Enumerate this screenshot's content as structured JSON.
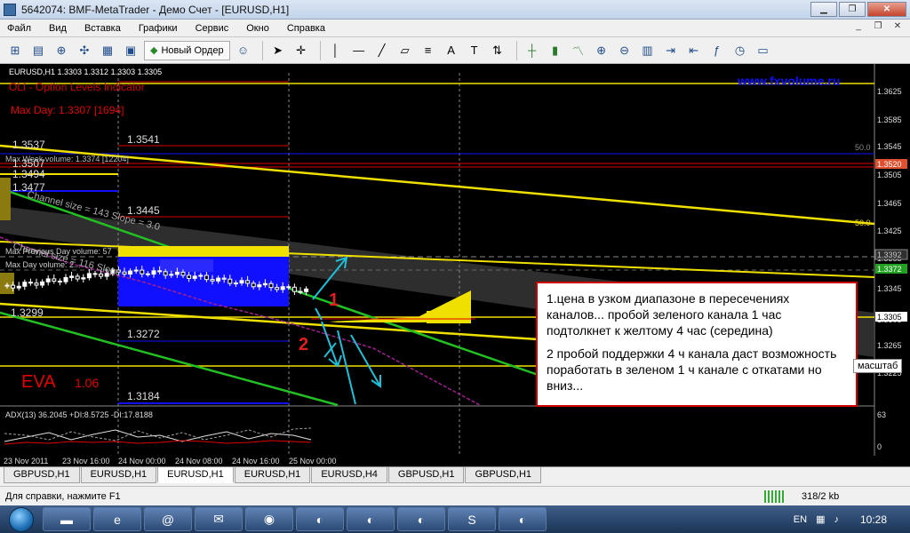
{
  "window": {
    "title": "5642074: BMF-MetaTrader - Демо Счет - [EURUSD,H1]",
    "buttons": [
      "▁",
      "❐",
      "✕"
    ]
  },
  "menu": [
    "Файл",
    "Вид",
    "Вставка",
    "Графики",
    "Сервис",
    "Окно",
    "Справка"
  ],
  "toolbar": {
    "new_order_label": "Новый Ордер"
  },
  "chart": {
    "symbol_info": "EURUSD,H1  1.3303 1.3312 1.3303 1.3305",
    "indicator_title": "OLI - Option Levels Indicator",
    "max_day": "Max Day: 1.3307 [1694]",
    "site": "www.fxvolume.ru",
    "max_week": "Max Week volume: 1.3374 [12204]",
    "channel1": "Channel size = 143 Slope = 3.0",
    "channel2": "Channel size = 116 Slope",
    "max_prev_day": "Max Previous Day volume: 57",
    "max_day_vol": "Max Day volume: 2...",
    "eva_label": "EVA",
    "eva_value": "1.06",
    "level_labels": [
      "1.3541",
      "1.3537",
      "1.3507",
      "1.3494",
      "1.3477",
      "1.3445",
      "1.3299",
      "1.3272",
      "1.3184"
    ],
    "level_50a": "50.0",
    "level_50b": "50.0",
    "mark1": "1",
    "mark2": "2",
    "adx_label": "ADX(13) 36.2045 +DI:8.5725 -DI:17.8188",
    "price_axis": [
      "1.3625",
      "1.3585",
      "1.3545",
      "1.3505",
      "1.3465",
      "1.3425",
      "1.3385",
      "1.3345",
      "1.3305",
      "1.3265",
      "1.3225"
    ],
    "price_tags": {
      "red": "1.3520",
      "green": "1.3372",
      "current": "1.3305",
      "grey": "1.3392"
    },
    "adx_axis": [
      "63",
      "0"
    ],
    "time_axis": [
      "23 Nov 2011",
      "23 Nov 16:00",
      "24 Nov 00:00",
      "24 Nov 08:00",
      "24 Nov 16:00",
      "25 Nov 00:00"
    ]
  },
  "annotation": {
    "p1": "1.цена в узком диапазоне в пересечениях каналов... пробой зеленого канала  1 час подтолкнет к  желтому 4 час  (середина)",
    "p2": "2 пробой поддержки 4 ч канала  даст возможность поработать в зеленом 1 ч канале  с откатами  но  вниз..."
  },
  "zoom_tip": "масштаб",
  "tabs": [
    "GBPUSD,H1",
    "EURUSD,H1",
    "EURUSD,H1",
    "EURUSD,H1",
    "EURUSD,H4",
    "GBPUSD,H1",
    "GBPUSD,H1"
  ],
  "active_tab": 2,
  "status": {
    "help": "Для справки, нажмите F1",
    "traffic": "318/2 kb"
  },
  "taskbar": {
    "lang": "EN",
    "time": "10:28"
  },
  "colors": {
    "chart_bg": "#000000",
    "yellow": "#f0e000",
    "green": "#22c022",
    "blue": "#1010ff",
    "red": "#e00000",
    "grid": "#4a4a4a"
  }
}
